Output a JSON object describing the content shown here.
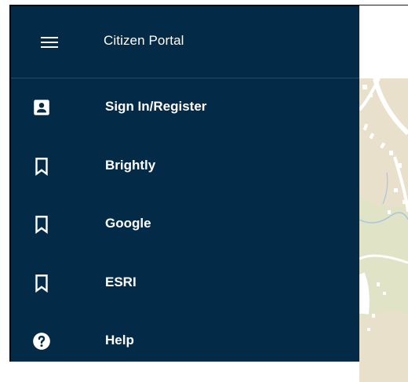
{
  "drawer": {
    "title": "Citizen Portal",
    "menu_icon": "hamburger-menu-icon",
    "background_color": "#032a47",
    "items": [
      {
        "label": "Sign In/Register",
        "icon": "account-box-icon"
      },
      {
        "label": "Brightly",
        "icon": "bookmark-icon"
      },
      {
        "label": "Google",
        "icon": "bookmark-icon"
      },
      {
        "label": "ESRI",
        "icon": "bookmark-icon"
      },
      {
        "label": "Help",
        "icon": "help-circle-icon"
      }
    ]
  },
  "map": {
    "background_color": "#e9e2cf"
  }
}
